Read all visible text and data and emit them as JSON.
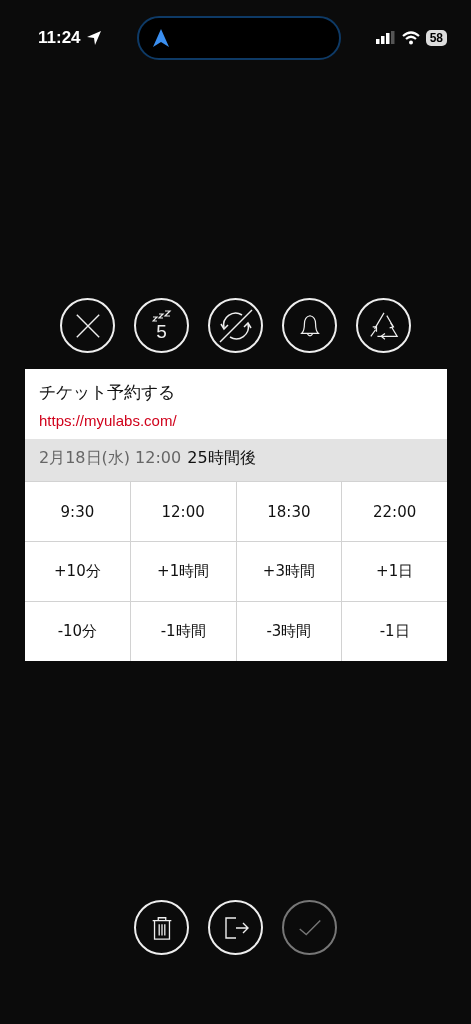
{
  "status_bar": {
    "time": "11:24",
    "battery": "58"
  },
  "top_actions": [
    {
      "kind": "close"
    },
    {
      "kind": "snooze",
      "label": "5"
    },
    {
      "kind": "no-repeat"
    },
    {
      "kind": "bell"
    },
    {
      "kind": "recycle"
    }
  ],
  "card": {
    "title": "チケット予約する",
    "url": "https://myulabs.com/",
    "date": "2月18日(水) 12:00",
    "relative": "25時間後"
  },
  "grid": [
    [
      "9:30",
      "12:00",
      "18:30",
      "22:00"
    ],
    [
      "+10分",
      "+1時間",
      "+3時間",
      "+1日"
    ],
    [
      "-10分",
      "-1時間",
      "-3時間",
      "-1日"
    ]
  ],
  "bottom_actions": [
    {
      "kind": "trash",
      "disabled": false
    },
    {
      "kind": "exit",
      "disabled": false
    },
    {
      "kind": "check",
      "disabled": true
    }
  ]
}
